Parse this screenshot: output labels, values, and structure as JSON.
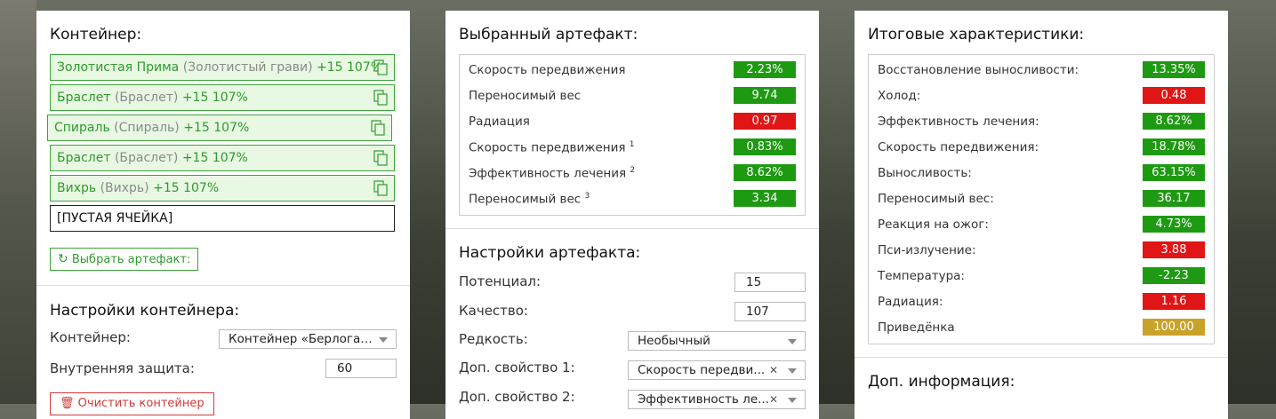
{
  "colors": {
    "green": "#1e9a12",
    "red": "#e01515",
    "gold": "#c9a22a",
    "accent": "#3ea33a"
  },
  "container": {
    "title": "Контейнер:",
    "slots": [
      {
        "name": "Золотистая Прима",
        "orig": "(Золотистый грави)",
        "bonus": "+15 107%",
        "filled": true
      },
      {
        "name": "Браслет",
        "orig": "(Браслет)",
        "bonus": "+15 107%",
        "filled": true
      },
      {
        "name": "Спираль",
        "orig": "(Спираль)",
        "bonus": "+15 107%",
        "filled": true
      },
      {
        "name": "Браслет",
        "orig": "(Браслет)",
        "bonus": "+15 107%",
        "filled": true
      },
      {
        "name": "Вихрь",
        "orig": "(Вихрь)",
        "bonus": "+15 107%",
        "filled": true
      }
    ],
    "empty_slot_label": "[ПУСТАЯ ЯЧЕЙКА]",
    "select_artifact_button": "Выбрать артефакт:"
  },
  "container_settings": {
    "title": "Настройки контейнера:",
    "container_label": "Контейнер:",
    "container_value": "Контейнер «Берлога…",
    "protection_label": "Внутренняя защита:",
    "protection_value": "60",
    "clear_button": "Очистить контейнер"
  },
  "selected_artifact": {
    "title": "Выбранный артефакт:",
    "stats": [
      {
        "name": "Скорость передвижения",
        "sup": "",
        "value": "2.23%",
        "color": "#1e9a12"
      },
      {
        "name": "Переносимый вес",
        "sup": "",
        "value": "9.74",
        "color": "#1e9a12"
      },
      {
        "name": "Радиация",
        "sup": "",
        "value": "0.97",
        "color": "#e01515"
      },
      {
        "name": "Скорость передвижения",
        "sup": "1",
        "value": "0.83%",
        "color": "#1e9a12"
      },
      {
        "name": "Эффективность лечения",
        "sup": "2",
        "value": "8.62%",
        "color": "#1e9a12"
      },
      {
        "name": "Переносимый вес",
        "sup": "3",
        "value": "3.34",
        "color": "#1e9a12"
      }
    ]
  },
  "artifact_settings": {
    "title": "Настройки артефакта:",
    "potential_label": "Потенциал:",
    "potential_value": "15",
    "quality_label": "Качество:",
    "quality_value": "107",
    "rarity_label": "Редкость:",
    "rarity_value": "Необычный",
    "extra1_label": "Доп. свойство 1:",
    "extra1_value": "Скорость передви...",
    "extra2_label": "Доп. свойство 2:",
    "extra2_value": "Эффективность ле..."
  },
  "totals": {
    "title": "Итоговые характеристики:",
    "stats": [
      {
        "name": "Восстановление выносливости:",
        "value": "13.35%",
        "color": "#1e9a12"
      },
      {
        "name": "Холод:",
        "value": "0.48",
        "color": "#e01515"
      },
      {
        "name": "Эффективность лечения:",
        "value": "8.62%",
        "color": "#1e9a12"
      },
      {
        "name": "Скорость передвижения:",
        "value": "18.78%",
        "color": "#1e9a12"
      },
      {
        "name": "Выносливость:",
        "value": "63.15%",
        "color": "#1e9a12"
      },
      {
        "name": "Переносимый вес:",
        "value": "36.17",
        "color": "#1e9a12"
      },
      {
        "name": "Реакция на ожог:",
        "value": "4.73%",
        "color": "#1e9a12"
      },
      {
        "name": "Пси-излучение:",
        "value": "3.88",
        "color": "#e01515"
      },
      {
        "name": "Температура:",
        "value": "-2.23",
        "color": "#1e9a12"
      },
      {
        "name": "Радиация:",
        "value": "1.16",
        "color": "#e01515"
      },
      {
        "name": "Приведёнка",
        "value": "100.00",
        "color": "#c9a22a"
      }
    ]
  },
  "extra_info": {
    "title": "Доп. информация:"
  }
}
